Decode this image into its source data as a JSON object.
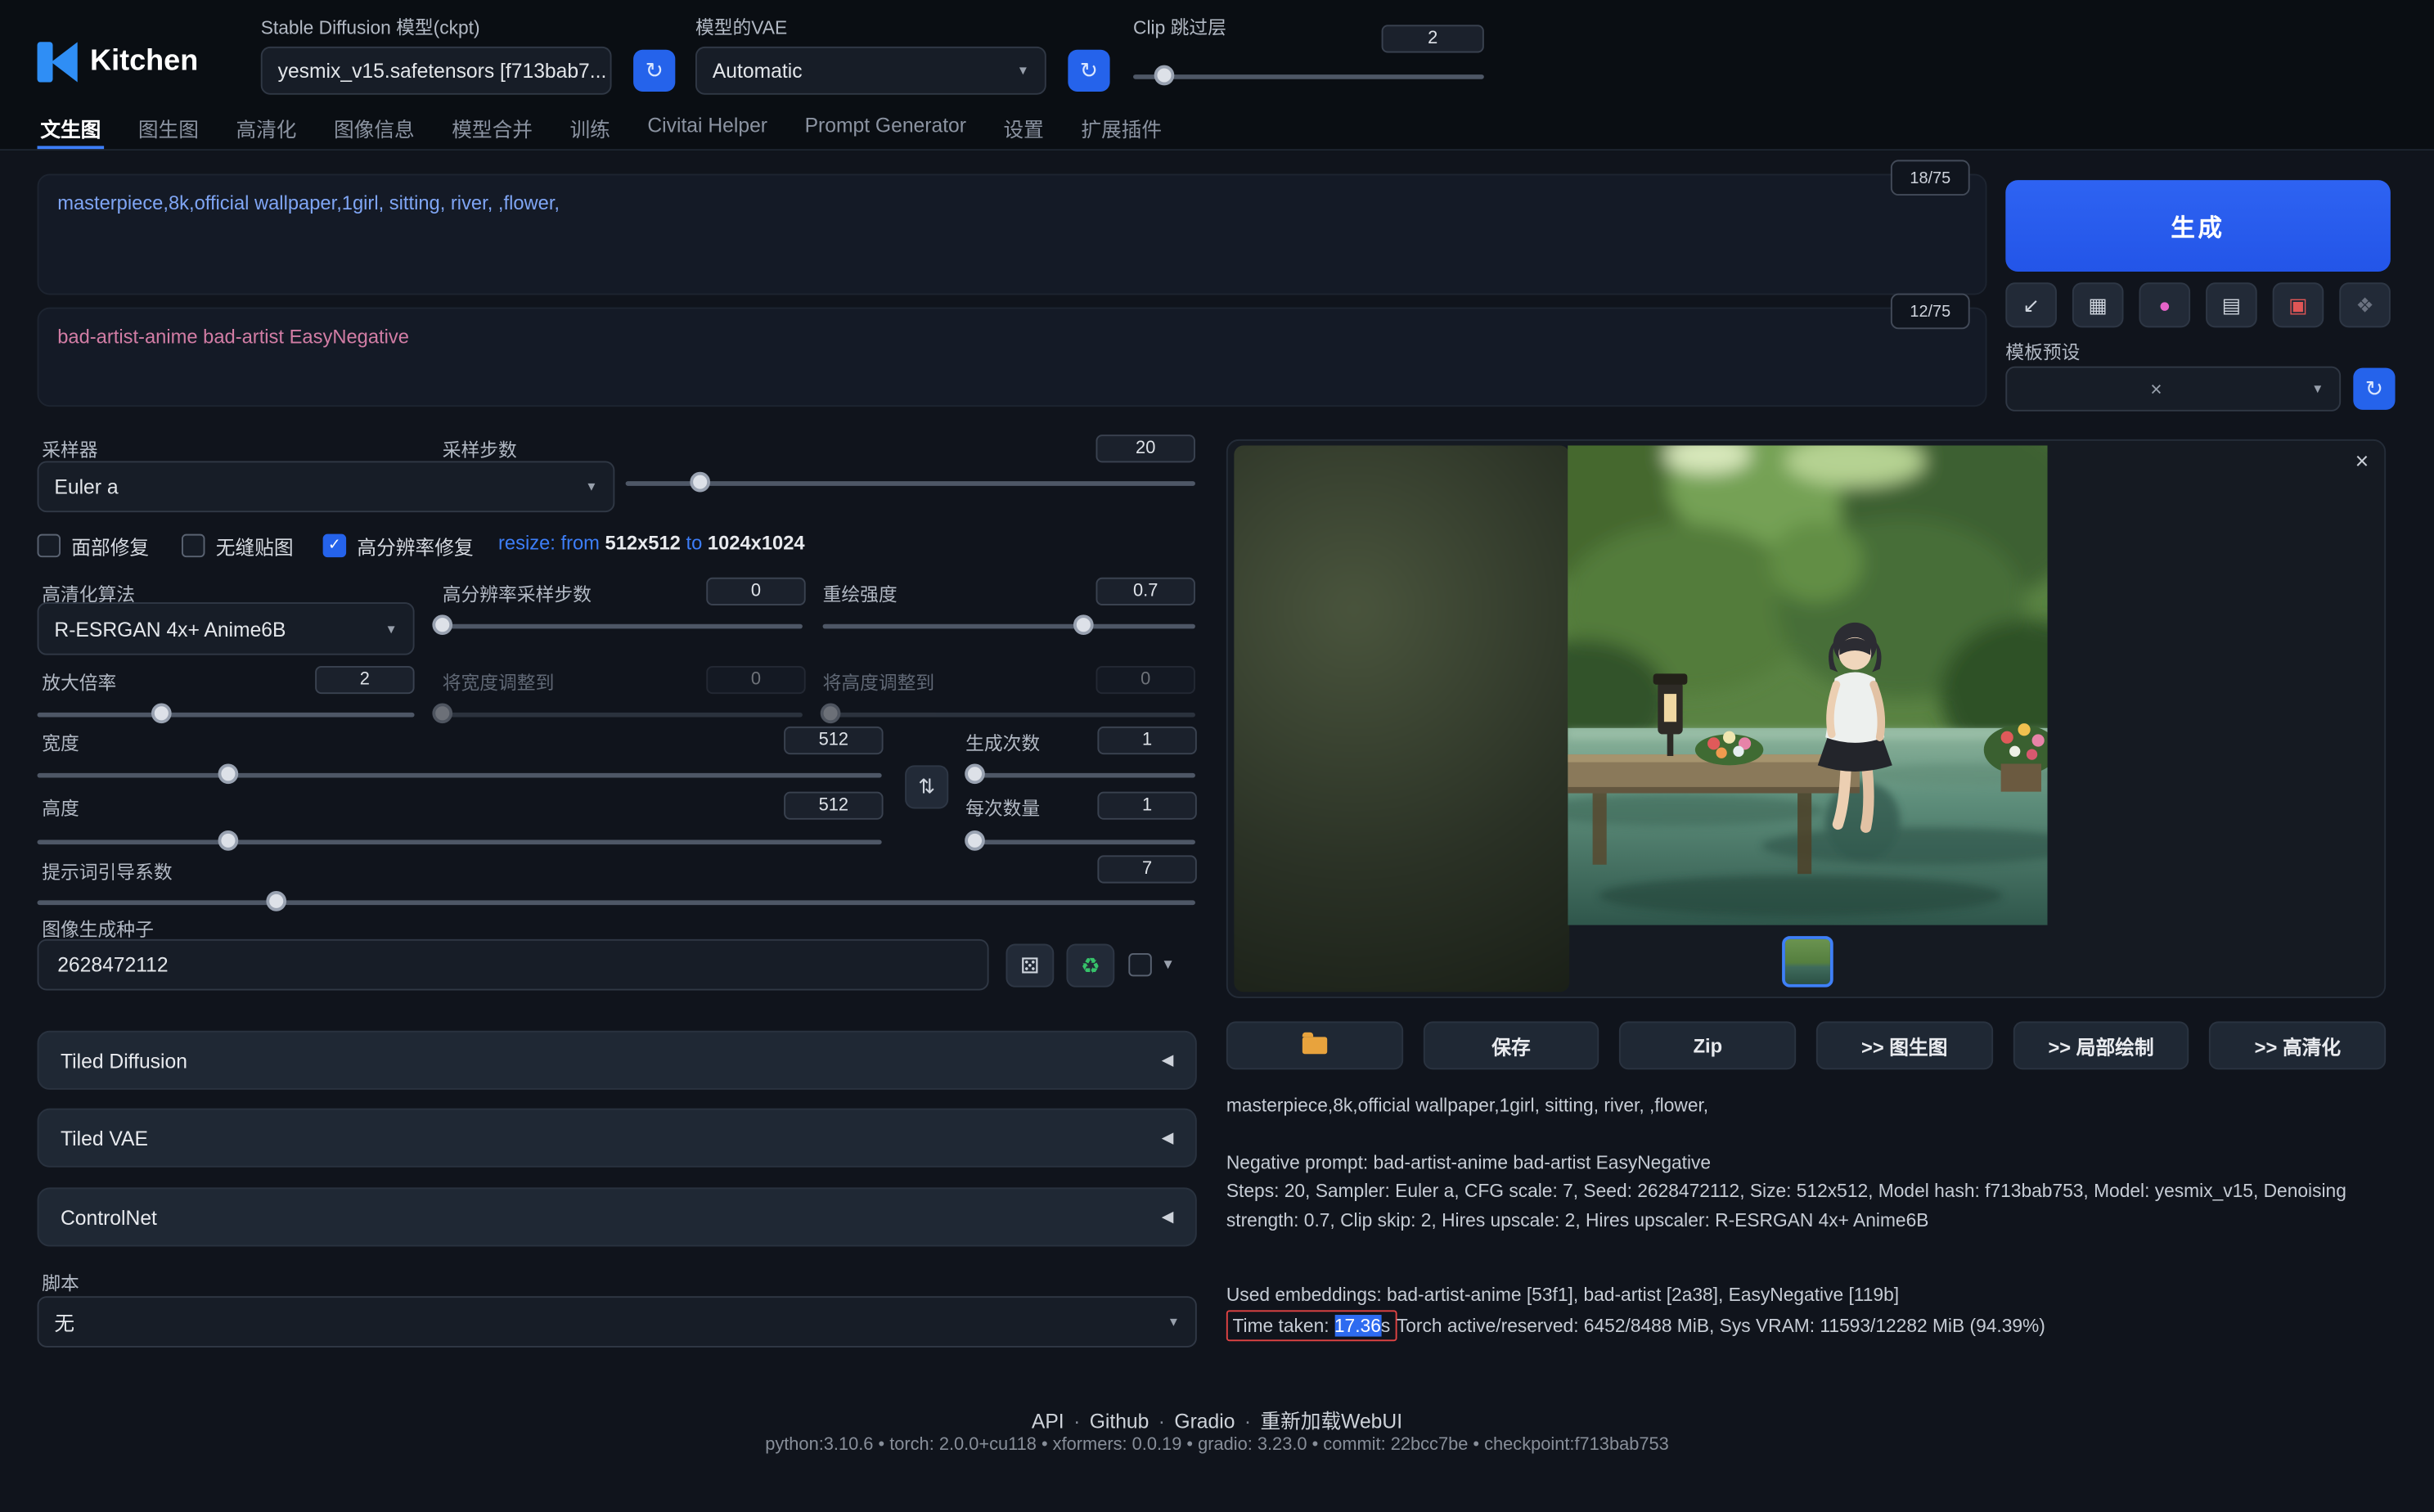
{
  "header": {
    "app_name": "Kitchen",
    "ckpt_label": "Stable Diffusion 模型(ckpt)",
    "ckpt_value": "yesmix_v15.safetensors [f713bab7...",
    "vae_label": "模型的VAE",
    "vae_value": "Automatic",
    "clip_skip_label": "Clip 跳过层",
    "clip_skip_value": "2"
  },
  "tabs": [
    "文生图",
    "图生图",
    "高清化",
    "图像信息",
    "模型合并",
    "训练",
    "Civitai Helper",
    "Prompt Generator",
    "设置",
    "扩展插件"
  ],
  "prompts": {
    "positive": "masterpiece,8k,official wallpaper,1girl, sitting, river, ,flower,",
    "positive_counter": "18/75",
    "negative": "bad-artist-anime bad-artist EasyNegative",
    "negative_counter": "12/75"
  },
  "generate": {
    "button_label": "生成",
    "preset_label": "模板预设"
  },
  "settings": {
    "sampler_label": "采样器",
    "sampler_value": "Euler a",
    "steps_label": "采样步数",
    "steps_value": "20",
    "restore_faces_label": "面部修复",
    "tiling_label": "无缝贴图",
    "hires_fix_label": "高分辨率修复",
    "hires_resize": {
      "prefix": "resize: from",
      "from_size": "512x512",
      "to_word": "to",
      "to_size": "1024x1024"
    },
    "upscaler_label": "高清化算法",
    "upscaler_value": "R-ESRGAN 4x+ Anime6B",
    "hires_steps_label": "高分辨率采样步数",
    "hires_steps_value": "0",
    "denoise_label": "重绘强度",
    "denoise_value": "0.7",
    "upscale_by_label": "放大倍率",
    "upscale_by_value": "2",
    "resize_w_label": "将宽度调整到",
    "resize_w_value": "0",
    "resize_h_label": "将高度调整到",
    "resize_h_value": "0",
    "width_label": "宽度",
    "width_value": "512",
    "height_label": "高度",
    "height_value": "512",
    "batch_count_label": "生成次数",
    "batch_count_value": "1",
    "batch_size_label": "每次数量",
    "batch_size_value": "1",
    "cfg_label": "提示词引导系数",
    "cfg_value": "7",
    "seed_label": "图像生成种子",
    "seed_value": "2628472112",
    "accordions": [
      "Tiled Diffusion",
      "Tiled VAE",
      "ControlNet"
    ],
    "script_label": "脚本",
    "script_value": "无"
  },
  "output": {
    "save_label": "保存",
    "zip_label": "Zip",
    "to_img2img_label": ">> 图生图",
    "to_inpaint_label": ">> 局部绘制",
    "to_extras_label": ">> 高清化",
    "info_prompt": "masterpiece,8k,official wallpaper,1girl, sitting, river, ,flower,",
    "info_negative": "Negative prompt: bad-artist-anime bad-artist EasyNegative",
    "info_params": "Steps: 20, Sampler: Euler a, CFG scale: 7, Seed: 2628472112, Size: 512x512, Model hash: f713bab753, Model: yesmix_v15, Denoising strength: 0.7, Clip skip: 2, Hires upscale: 2, Hires upscaler: R-ESRGAN 4x+ Anime6B",
    "info_embeddings": "Used embeddings: bad-artist-anime [53f1], bad-artist [2a38], EasyNegative [119b]",
    "time_label": "Time taken: ",
    "time_value": "17.36",
    "time_suffix": "s",
    "vram_info": "Torch active/reserved: 6452/8488 MiB, Sys VRAM: 11593/12282 MiB (94.39%)"
  },
  "footer": {
    "links": [
      "API",
      "Github",
      "Gradio",
      "重新加载WebUI"
    ],
    "sep": "·",
    "versions": "python:3.10.6  •  torch: 2.0.0+cu118  •  xformers: 0.0.19  •  gradio: 3.23.0  •  commit: 22bcc7be •  checkpoint:f713bab753"
  },
  "icons": {
    "refresh": "↻",
    "caret": "▼",
    "close": "×",
    "collapse": "◀",
    "swap": "⇅",
    "dice": "⚄",
    "recycle": "♻",
    "paste": "↙",
    "clear": "▦",
    "palette": "●",
    "clipboard": "▤",
    "save_style": "▣",
    "extra": "❖",
    "check": "✓"
  },
  "colors": {
    "accent": "#2563eb",
    "positive_prompt": "#7fa5f4",
    "negative_prompt": "#d27da5",
    "selection": "#2e6bf0",
    "time_box_border": "#e24444"
  }
}
